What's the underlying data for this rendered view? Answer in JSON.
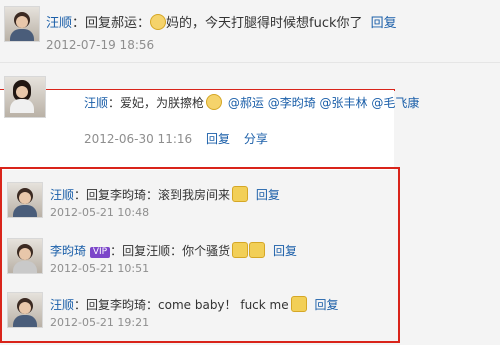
{
  "comments": [
    {
      "name": "汪顺",
      "text_a": "：回复郝运：",
      "text_b": "妈的，今天打腿得时候想fuck你了",
      "reply": "回复",
      "time": "2012-07-19 18:56"
    },
    {
      "name": "汪顺",
      "text": "：爱妃，为朕擦枪",
      "mentions": [
        "@郝运",
        "@李昀琦",
        "@张丰林",
        "@毛飞康"
      ],
      "time": "2012-06-30 11:16",
      "reply": "回复",
      "share": "分享"
    },
    {
      "name": "汪顺",
      "text": "：回复李昀琦：滚到我房间来",
      "reply": "回复",
      "time": "2012-05-21 10:48"
    },
    {
      "name": "李昀琦",
      "badge": "VIP",
      "text": "：回复汪顺：你个骚货",
      "reply": "回复",
      "time": "2012-05-21 10:51"
    },
    {
      "name": "汪顺",
      "text": "：回复李昀琦：come baby！ fuck me",
      "reply": "回复",
      "time": "2012-05-21 19:21"
    }
  ],
  "icons": {
    "emoji_1": "emoticon-face",
    "emoji_2": "emoticon-face",
    "emoji_3": "emoticon-face",
    "emoji_4": "emoticon-face",
    "emoji_5": "emoticon-face"
  },
  "colors": {
    "name_link": "#1b5fa9",
    "timestamp": "#8e8e8e",
    "highlight_frame": "#d9241a",
    "background": "#f4f4f4"
  }
}
